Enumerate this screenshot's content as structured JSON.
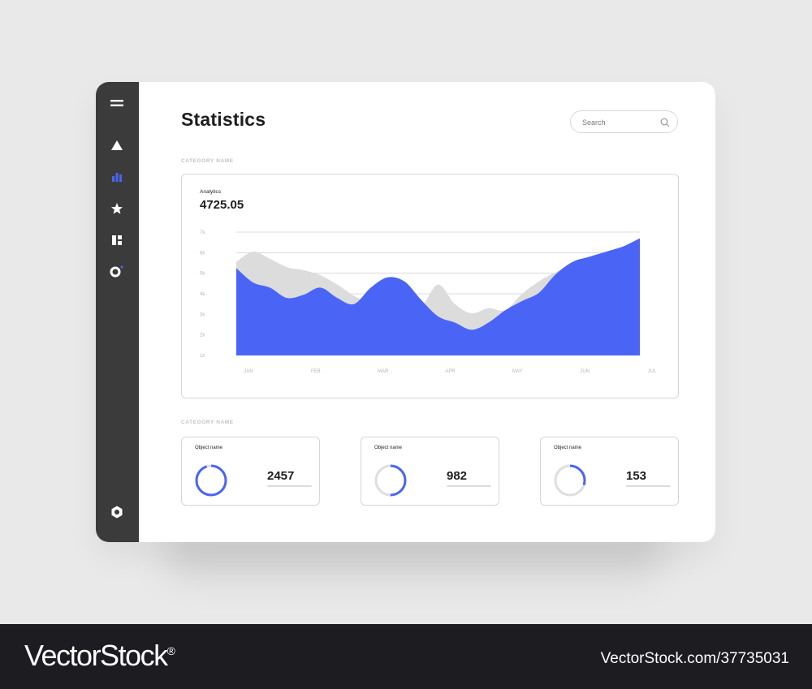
{
  "sidebar": {
    "items": [
      {
        "icon": "menu-icon",
        "active": false
      },
      {
        "icon": "triangle-icon",
        "active": false
      },
      {
        "icon": "bar-chart-icon",
        "active": true
      },
      {
        "icon": "star-icon",
        "active": false
      },
      {
        "icon": "dashboard-icon",
        "active": false
      },
      {
        "icon": "ring-notification-icon",
        "active": false
      },
      {
        "icon": "settings-hexagon-icon",
        "active": false
      }
    ],
    "accent": "#4a64f5",
    "icon_color": "#ffffff"
  },
  "header": {
    "title": "Statistics",
    "search": {
      "placeholder": "Search",
      "value": "",
      "icon": "search-icon"
    }
  },
  "sections": [
    {
      "label": "CATEGORY NAME"
    },
    {
      "label": "CATEGORY NAME"
    }
  ],
  "analytics": {
    "label": "Analytics",
    "value": "4725.05"
  },
  "chart_data": {
    "type": "area",
    "x": [
      "JAN",
      "FEB",
      "MAR",
      "APR",
      "MAY",
      "JUN",
      "JUL"
    ],
    "y_ticks": [
      "7k",
      "6k",
      "5k",
      "4k",
      "3k",
      "2k",
      "1k"
    ],
    "ylim": [
      1000,
      7000
    ],
    "grid": true,
    "series": [
      {
        "color": "#dcdcdc",
        "points": [
          [
            0,
            5.55
          ],
          [
            0.25,
            6.05
          ],
          [
            0.5,
            5.7
          ],
          [
            0.75,
            5.3
          ],
          [
            1,
            5.15
          ],
          [
            1.25,
            4.9
          ],
          [
            1.5,
            4.45
          ],
          [
            1.75,
            3.9
          ],
          [
            2,
            3.5
          ],
          [
            2.25,
            3.2
          ],
          [
            2.5,
            3.0
          ],
          [
            2.75,
            3.35
          ],
          [
            3,
            4.45
          ],
          [
            3.25,
            3.5
          ],
          [
            3.5,
            3.05
          ],
          [
            3.75,
            3.3
          ],
          [
            4,
            3.2
          ],
          [
            4.25,
            4.0
          ],
          [
            4.5,
            4.6
          ],
          [
            4.75,
            5.05
          ],
          [
            5,
            5.4
          ],
          [
            5.25,
            5.8
          ],
          [
            5.5,
            6.05
          ],
          [
            5.75,
            6.3
          ],
          [
            6,
            6.7
          ]
        ]
      },
      {
        "color": "#4a64f5",
        "points": [
          [
            0,
            5.25
          ],
          [
            0.25,
            4.55
          ],
          [
            0.5,
            4.3
          ],
          [
            0.75,
            3.8
          ],
          [
            1,
            3.95
          ],
          [
            1.25,
            4.3
          ],
          [
            1.5,
            3.8
          ],
          [
            1.75,
            3.5
          ],
          [
            2,
            4.3
          ],
          [
            2.25,
            4.8
          ],
          [
            2.5,
            4.6
          ],
          [
            2.75,
            3.7
          ],
          [
            3,
            2.9
          ],
          [
            3.25,
            2.6
          ],
          [
            3.5,
            2.25
          ],
          [
            3.75,
            2.6
          ],
          [
            4,
            3.2
          ],
          [
            4.25,
            3.65
          ],
          [
            4.5,
            4.05
          ],
          [
            4.75,
            4.95
          ],
          [
            5,
            5.55
          ],
          [
            5.25,
            5.8
          ],
          [
            5.5,
            6.05
          ],
          [
            5.75,
            6.3
          ],
          [
            6,
            6.7
          ]
        ]
      }
    ]
  },
  "stats": [
    {
      "name": "Object name",
      "value": "2457",
      "progress": 0.95
    },
    {
      "name": "Object name",
      "value": "982",
      "progress": 0.5
    },
    {
      "name": "Object name",
      "value": "153",
      "progress": 0.3
    }
  ],
  "colors": {
    "ring_track": "#dedede",
    "ring_fill": "#4a64f5"
  },
  "watermark": {
    "brand": "VectorStock",
    "reg": "®",
    "image_id": "VectorStock.com/37735031"
  }
}
